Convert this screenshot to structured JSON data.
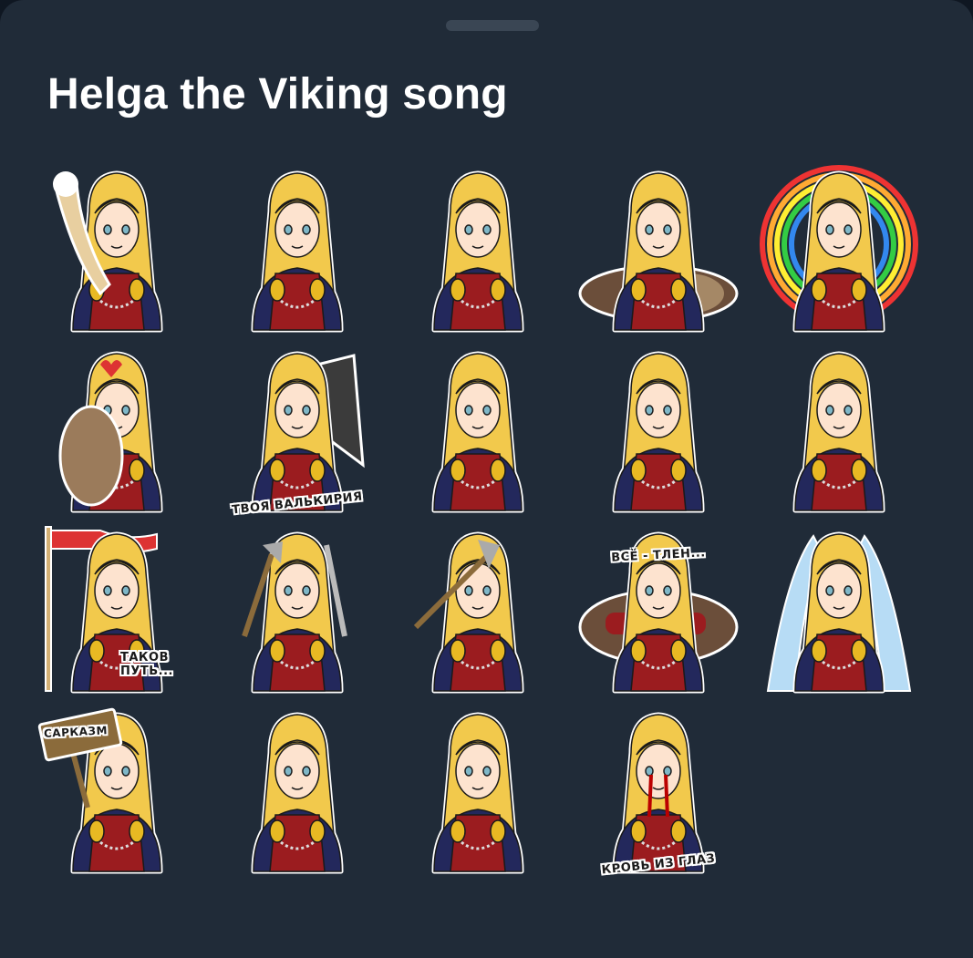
{
  "pack": {
    "title": "Helga the Viking song",
    "colors": {
      "background": "#202b38",
      "handle": "#3a4654",
      "hair": "#f2c94c",
      "dress": "#9b1c1f",
      "sleeve": "#23285c",
      "brooch": "#e8b923"
    }
  },
  "stickers": [
    {
      "id": "horn-of-mead",
      "caption": ""
    },
    {
      "id": "wink-braid",
      "caption": ""
    },
    {
      "id": "joy-arms-up",
      "caption": ""
    },
    {
      "id": "tea-with-cat",
      "caption": ""
    },
    {
      "id": "rainbow-blush",
      "caption": ""
    },
    {
      "id": "hug-cat",
      "caption": ""
    },
    {
      "id": "valkyrie",
      "caption": "ТВОЯ ВАЛЬКИРИЯ"
    },
    {
      "id": "confused",
      "caption": ""
    },
    {
      "id": "shy-fingers",
      "caption": ""
    },
    {
      "id": "smug-look",
      "caption": ""
    },
    {
      "id": "banner",
      "caption": "ТАКОВ ПУТЬ..."
    },
    {
      "id": "axe-and-sword",
      "caption": ""
    },
    {
      "id": "angry-axe",
      "caption": ""
    },
    {
      "id": "lying-down",
      "caption": "ВСЁ - ТЛЕН..."
    },
    {
      "id": "crying-waterfall",
      "caption": ""
    },
    {
      "id": "sarcasm-sign",
      "caption": "",
      "sign_text": "САРКАЗМ"
    },
    {
      "id": "tears",
      "caption": ""
    },
    {
      "id": "hands-on-hips",
      "caption": ""
    },
    {
      "id": "blood-tears",
      "caption": "КРОВЬ ИЗ ГЛАЗ"
    }
  ]
}
